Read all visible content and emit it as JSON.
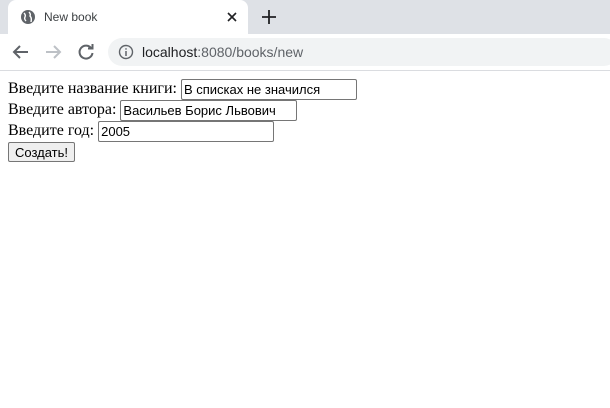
{
  "browser": {
    "tab": {
      "title": "New book",
      "favicon": "globe-icon"
    },
    "address": {
      "host": "localhost",
      "rest": ":8080/books/new"
    }
  },
  "form": {
    "title_label": "Введите название книги:",
    "title_value": "В списках не значился",
    "author_label": "Введите автора:",
    "author_value": "Васильев Борис Львович",
    "year_label": "Введите год:",
    "year_value": "2005",
    "submit_label": "Создать!"
  }
}
